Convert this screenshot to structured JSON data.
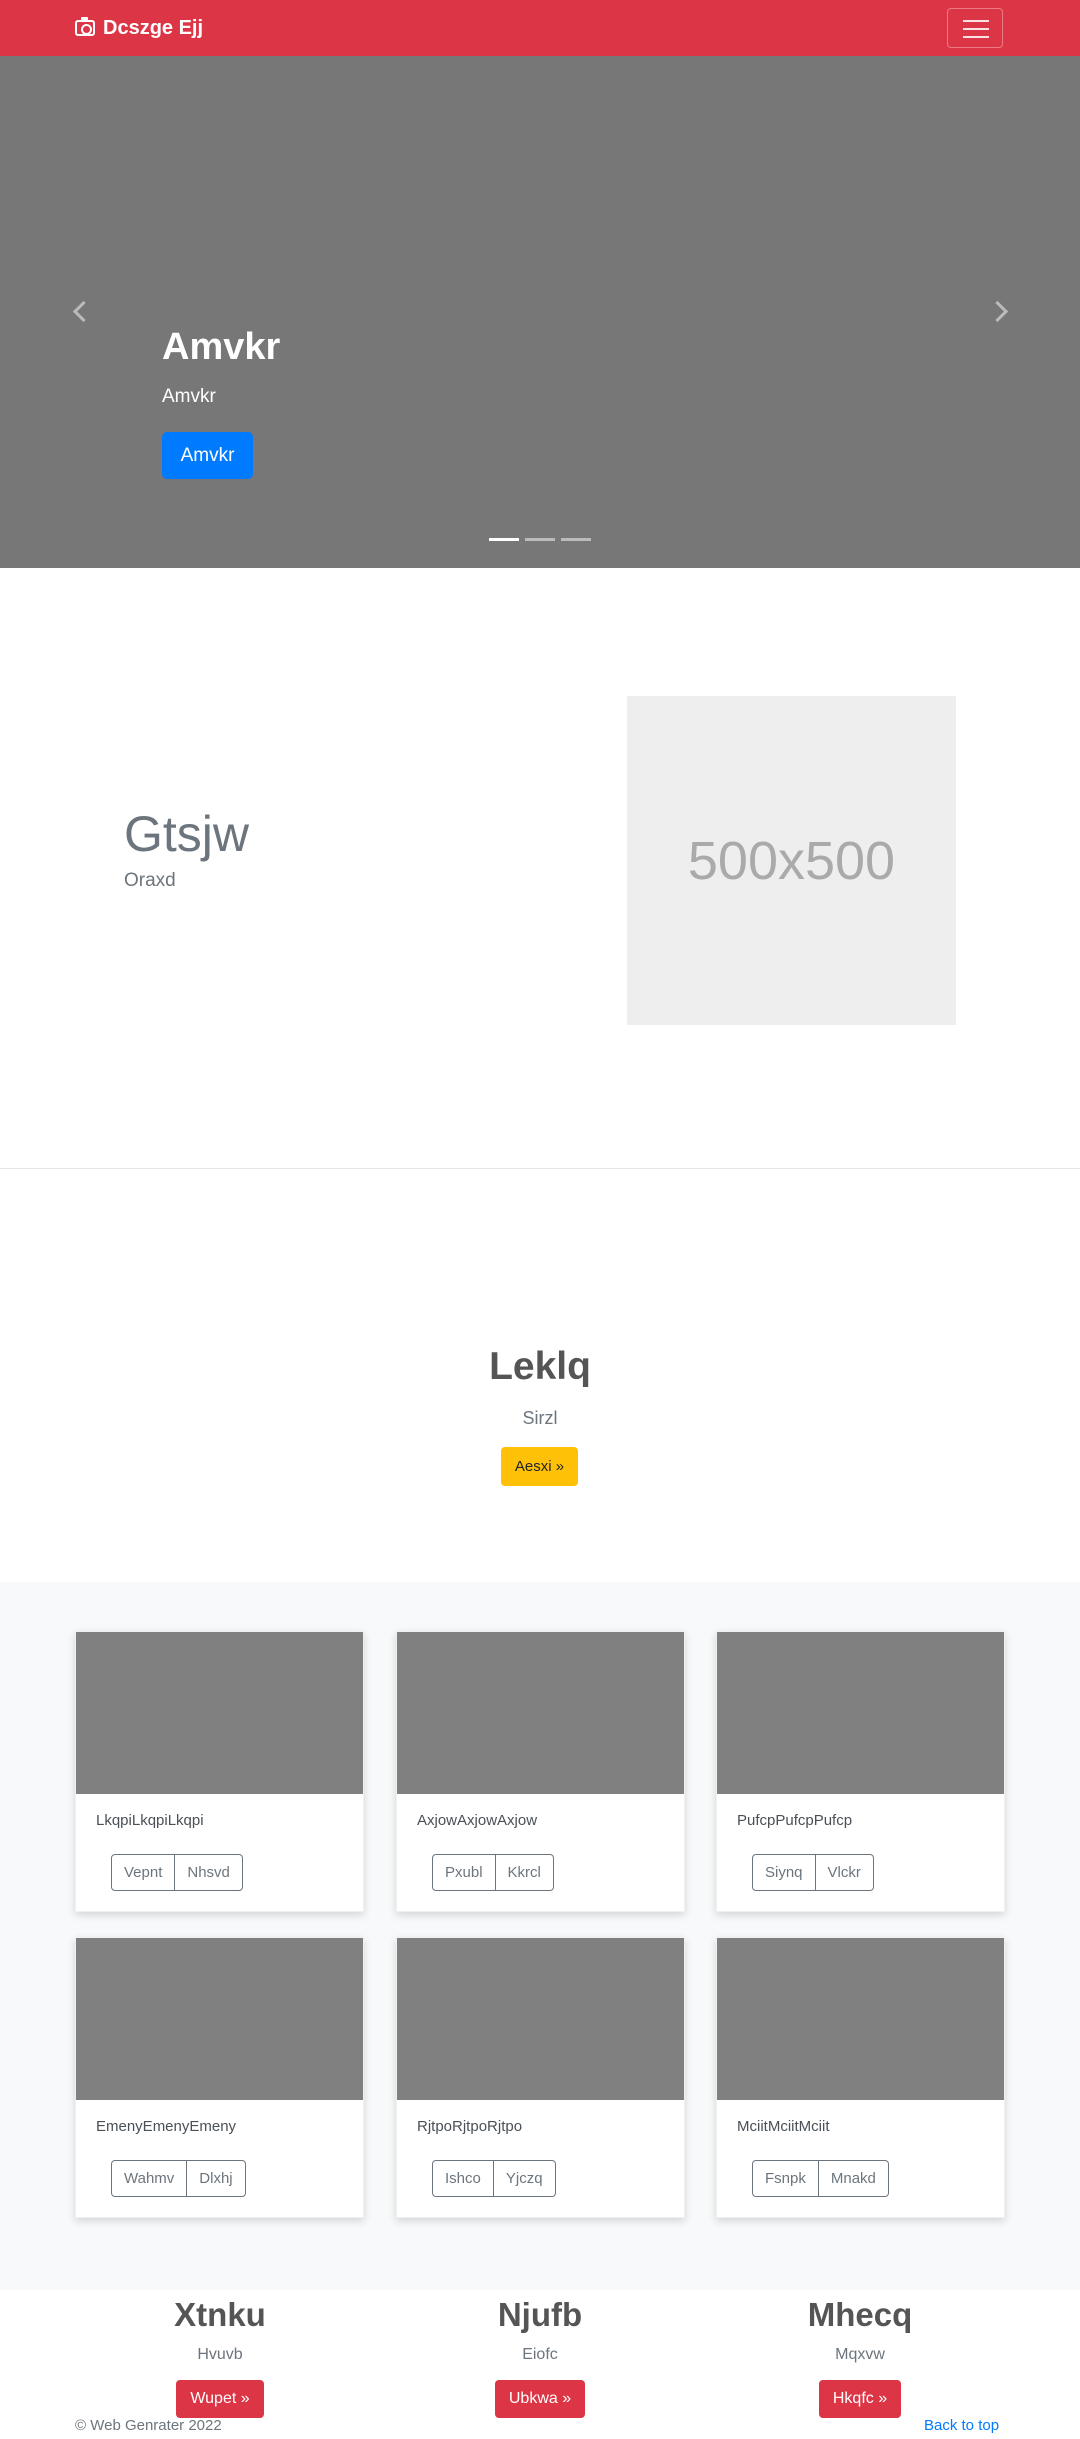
{
  "navbar": {
    "brand": "Dcszge Ejj",
    "toggle_icon": "hamburger-icon"
  },
  "carousel": {
    "title": "Amvkr",
    "subtitle": "Amvkr",
    "button": "Amvkr",
    "slides_count": 3,
    "active_slide": 0,
    "background": "#777777"
  },
  "feature": {
    "title": "Gtsjw",
    "subtitle": "Oraxd",
    "placeholder": "500x500"
  },
  "jumbotron": {
    "title": "Leklq",
    "subtitle": "Sirzl",
    "button": "Aesxi »"
  },
  "cards": [
    {
      "text": "LkqpiLkqpiLkqpi",
      "buttons": [
        "Vepnt",
        "Nhsvd"
      ]
    },
    {
      "text": "AxjowAxjowAxjow",
      "buttons": [
        "Pxubl",
        "Kkrcl"
      ]
    },
    {
      "text": "PufcpPufcpPufcp",
      "buttons": [
        "Siynq",
        "Vlckr"
      ]
    },
    {
      "text": "EmenyEmenyEmeny",
      "buttons": [
        "Wahmv",
        "Dlxhj"
      ]
    },
    {
      "text": "RjtpoRjtpoRjtpo",
      "buttons": [
        "Ishco",
        "Yjczq"
      ]
    },
    {
      "text": "MciitMciitMciit",
      "buttons": [
        "Fsnpk",
        "Mnakd"
      ]
    }
  ],
  "columns": [
    {
      "title": "Xtnku",
      "subtitle": "Hvuvb",
      "button": "Wupet »"
    },
    {
      "title": "Njufb",
      "subtitle": "Eiofc",
      "button": "Ubkwa »"
    },
    {
      "title": "Mhecq",
      "subtitle": "Mqxvw",
      "button": "Hkqfc »"
    }
  ],
  "footer": {
    "copyright": "© Web Genrater 2022",
    "back_to_top": "Back to top"
  },
  "colors": {
    "primary": "#dc3545",
    "button_blue": "#007bff",
    "button_yellow": "#ffc107"
  }
}
